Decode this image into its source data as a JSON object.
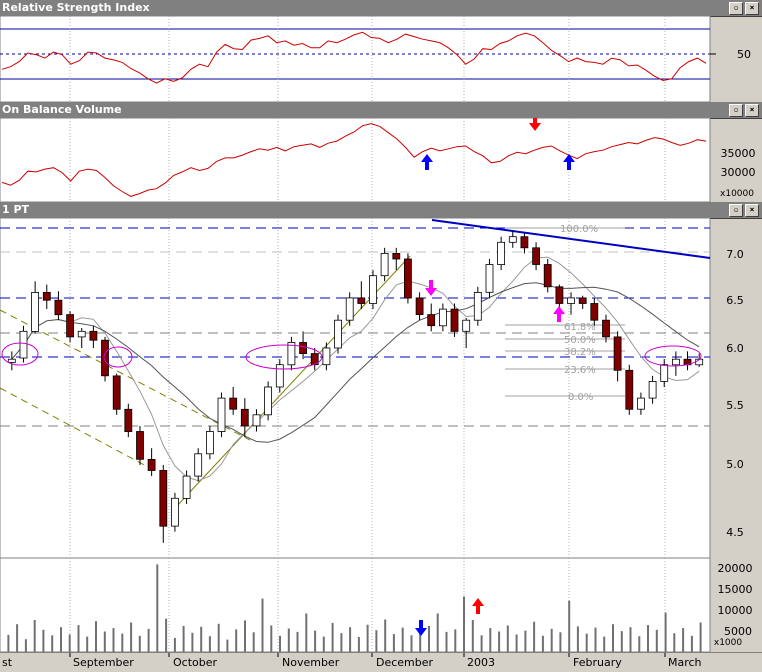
{
  "rsi": {
    "title": "Relative Strength Index",
    "tick": "50"
  },
  "obv": {
    "title": "On Balance Volume",
    "ticks": [
      "35000",
      "30000"
    ],
    "unit": "x10000"
  },
  "price": {
    "title": "1 PT",
    "ticks": [
      "7.0",
      "6.5",
      "6.0",
      "5.5",
      "5.0",
      "4.5"
    ],
    "fib_labels": [
      "100.0%",
      "61.8%",
      "50.0%",
      "38.2%",
      "23.6%",
      "0.0%"
    ]
  },
  "volume": {
    "ticks": [
      "20000",
      "15000",
      "10000",
      "5000"
    ],
    "unit": "x1000"
  },
  "xaxis": {
    "labels": [
      "st",
      "September",
      "October",
      "November",
      "December",
      "2003",
      "February",
      "March"
    ]
  },
  "colors": {
    "rsi_line": "#cc0000",
    "obv_line": "#cc0000",
    "up_candle": "#ffffff",
    "down_candle": "#800000",
    "trend_blue": "#0000c0",
    "ellipse": "#cc00cc"
  },
  "chart_data": [
    {
      "type": "line",
      "name": "Relative Strength Index",
      "ylim": [
        0,
        100
      ],
      "reference_lines": [
        70,
        50,
        30
      ],
      "values": [
        38,
        41,
        47,
        57,
        55,
        51,
        58,
        55,
        44,
        48,
        58,
        57,
        51,
        49,
        46,
        39,
        34,
        27,
        22,
        27,
        24,
        28,
        38,
        44,
        41,
        58,
        67,
        62,
        61,
        72,
        74,
        77,
        69,
        71,
        66,
        68,
        63,
        63,
        71,
        69,
        73,
        78,
        81,
        75,
        74,
        69,
        73,
        79,
        76,
        73,
        71,
        69,
        63,
        55,
        44,
        50,
        62,
        61,
        68,
        71,
        77,
        80,
        77,
        69,
        60,
        54,
        47,
        51,
        47,
        46,
        44,
        51,
        49,
        42,
        43,
        37,
        30,
        25,
        27,
        40,
        47,
        51,
        45
      ]
    },
    {
      "type": "line",
      "name": "On Balance Volume",
      "ylim": [
        28000,
        40000
      ],
      "values": [
        30800,
        30400,
        31100,
        32400,
        32300,
        32700,
        32900,
        32200,
        31000,
        32400,
        32700,
        32500,
        31500,
        30300,
        29500,
        28800,
        29200,
        29700,
        29900,
        30700,
        31800,
        32300,
        32900,
        32500,
        32800,
        33800,
        34300,
        34300,
        34700,
        35200,
        35600,
        35400,
        35800,
        35300,
        35900,
        36100,
        36300,
        35800,
        36400,
        36700,
        37400,
        38000,
        38900,
        39200,
        38800,
        37900,
        37000,
        35800,
        34400,
        35200,
        35700,
        35300,
        35600,
        35900,
        36000,
        35200,
        34600,
        33600,
        33800,
        34600,
        35100,
        34900,
        35400,
        35800,
        36000,
        35300,
        34700,
        34200,
        34900,
        35200,
        35400,
        35900,
        36200,
        36500,
        36300,
        36800,
        37200,
        37000,
        36500,
        36100,
        36400,
        36900,
        36700
      ]
    },
    {
      "type": "candlestick",
      "name": "1 PT",
      "ylim": [
        4.3,
        7.3
      ],
      "ohlc": [
        [
          6.02,
          6.12,
          5.95,
          6.05
        ],
        [
          6.06,
          6.35,
          6.02,
          6.3
        ],
        [
          6.3,
          6.75,
          6.28,
          6.65
        ],
        [
          6.65,
          6.72,
          6.5,
          6.58
        ],
        [
          6.58,
          6.66,
          6.4,
          6.45
        ],
        [
          6.45,
          6.48,
          6.2,
          6.25
        ],
        [
          6.25,
          6.33,
          6.15,
          6.3
        ],
        [
          6.3,
          6.35,
          6.15,
          6.22
        ],
        [
          6.22,
          6.25,
          5.85,
          5.9
        ],
        [
          5.9,
          5.92,
          5.55,
          5.6
        ],
        [
          5.6,
          5.65,
          5.35,
          5.4
        ],
        [
          5.4,
          5.45,
          5.1,
          5.15
        ],
        [
          5.15,
          5.25,
          5.0,
          5.05
        ],
        [
          5.05,
          5.1,
          4.4,
          4.55
        ],
        [
          4.55,
          4.85,
          4.5,
          4.8
        ],
        [
          4.8,
          5.05,
          4.75,
          5.0
        ],
        [
          5.0,
          5.25,
          4.95,
          5.2
        ],
        [
          5.2,
          5.45,
          5.15,
          5.4
        ],
        [
          5.4,
          5.75,
          5.35,
          5.7
        ],
        [
          5.7,
          5.8,
          5.55,
          5.6
        ],
        [
          5.6,
          5.7,
          5.35,
          5.45
        ],
        [
          5.45,
          5.6,
          5.4,
          5.55
        ],
        [
          5.55,
          5.85,
          5.5,
          5.8
        ],
        [
          5.8,
          6.05,
          5.75,
          6.0
        ],
        [
          6.0,
          6.25,
          5.95,
          6.2
        ],
        [
          6.2,
          6.3,
          6.05,
          6.1
        ],
        [
          6.1,
          6.15,
          5.95,
          6.0
        ],
        [
          6.0,
          6.2,
          5.95,
          6.15
        ],
        [
          6.15,
          6.45,
          6.1,
          6.4
        ],
        [
          6.4,
          6.65,
          6.35,
          6.6
        ],
        [
          6.6,
          6.75,
          6.5,
          6.55
        ],
        [
          6.55,
          6.85,
          6.5,
          6.8
        ],
        [
          6.8,
          7.05,
          6.75,
          7.0
        ],
        [
          7.0,
          7.05,
          6.85,
          6.95
        ],
        [
          6.95,
          7.0,
          6.55,
          6.6
        ],
        [
          6.6,
          6.65,
          6.4,
          6.45
        ],
        [
          6.45,
          6.55,
          6.3,
          6.35
        ],
        [
          6.35,
          6.55,
          6.3,
          6.5
        ],
        [
          6.5,
          6.55,
          6.25,
          6.3
        ],
        [
          6.3,
          6.42,
          6.15,
          6.4
        ],
        [
          6.4,
          6.7,
          6.35,
          6.65
        ],
        [
          6.65,
          6.95,
          6.6,
          6.9
        ],
        [
          6.9,
          7.15,
          6.85,
          7.1
        ],
        [
          7.1,
          7.2,
          7.05,
          7.15
        ],
        [
          7.15,
          7.18,
          7.0,
          7.05
        ],
        [
          7.05,
          7.1,
          6.85,
          6.9
        ],
        [
          6.9,
          6.95,
          6.65,
          6.7
        ],
        [
          6.7,
          6.72,
          6.5,
          6.55
        ],
        [
          6.55,
          6.65,
          6.45,
          6.6
        ],
        [
          6.6,
          6.62,
          6.5,
          6.55
        ],
        [
          6.55,
          6.6,
          6.35,
          6.4
        ],
        [
          6.4,
          6.45,
          6.2,
          6.25
        ],
        [
          6.25,
          6.3,
          5.85,
          5.95
        ],
        [
          5.95,
          6.0,
          5.55,
          5.6
        ],
        [
          5.6,
          5.75,
          5.55,
          5.7
        ],
        [
          5.7,
          5.9,
          5.65,
          5.85
        ],
        [
          5.85,
          6.05,
          5.8,
          6.0
        ],
        [
          6.0,
          6.12,
          5.9,
          6.05
        ],
        [
          6.05,
          6.12,
          5.95,
          6.0
        ],
        [
          6.0,
          6.1,
          5.98,
          6.05
        ]
      ]
    },
    {
      "type": "bar",
      "name": "Volume",
      "ylim": [
        0,
        22000
      ],
      "values": [
        4000,
        6500,
        3000,
        7500,
        5200,
        3900,
        5800,
        4100,
        6300,
        3600,
        7200,
        4800,
        5600,
        4300,
        6900,
        3800,
        5400,
        20500,
        7800,
        3300,
        6100,
        4500,
        5900,
        3700,
        6600,
        2900,
        5300,
        7400,
        4600,
        12500,
        6200,
        3800,
        5500,
        4700,
        9000,
        5000,
        3600,
        6800,
        4400,
        5800,
        3500,
        6400,
        5100,
        7600,
        4200,
        5700,
        3900,
        6800,
        6100,
        9000,
        4700,
        5300,
        13000,
        7500,
        3900,
        5600,
        4800,
        6200,
        4100,
        5000,
        7100,
        3800,
        5400,
        4600,
        12000,
        6000,
        4300,
        5700,
        3600,
        6500,
        4900,
        5800,
        3700,
        6300,
        5200,
        9200,
        4400,
        5600,
        3800,
        6900
      ]
    }
  ]
}
